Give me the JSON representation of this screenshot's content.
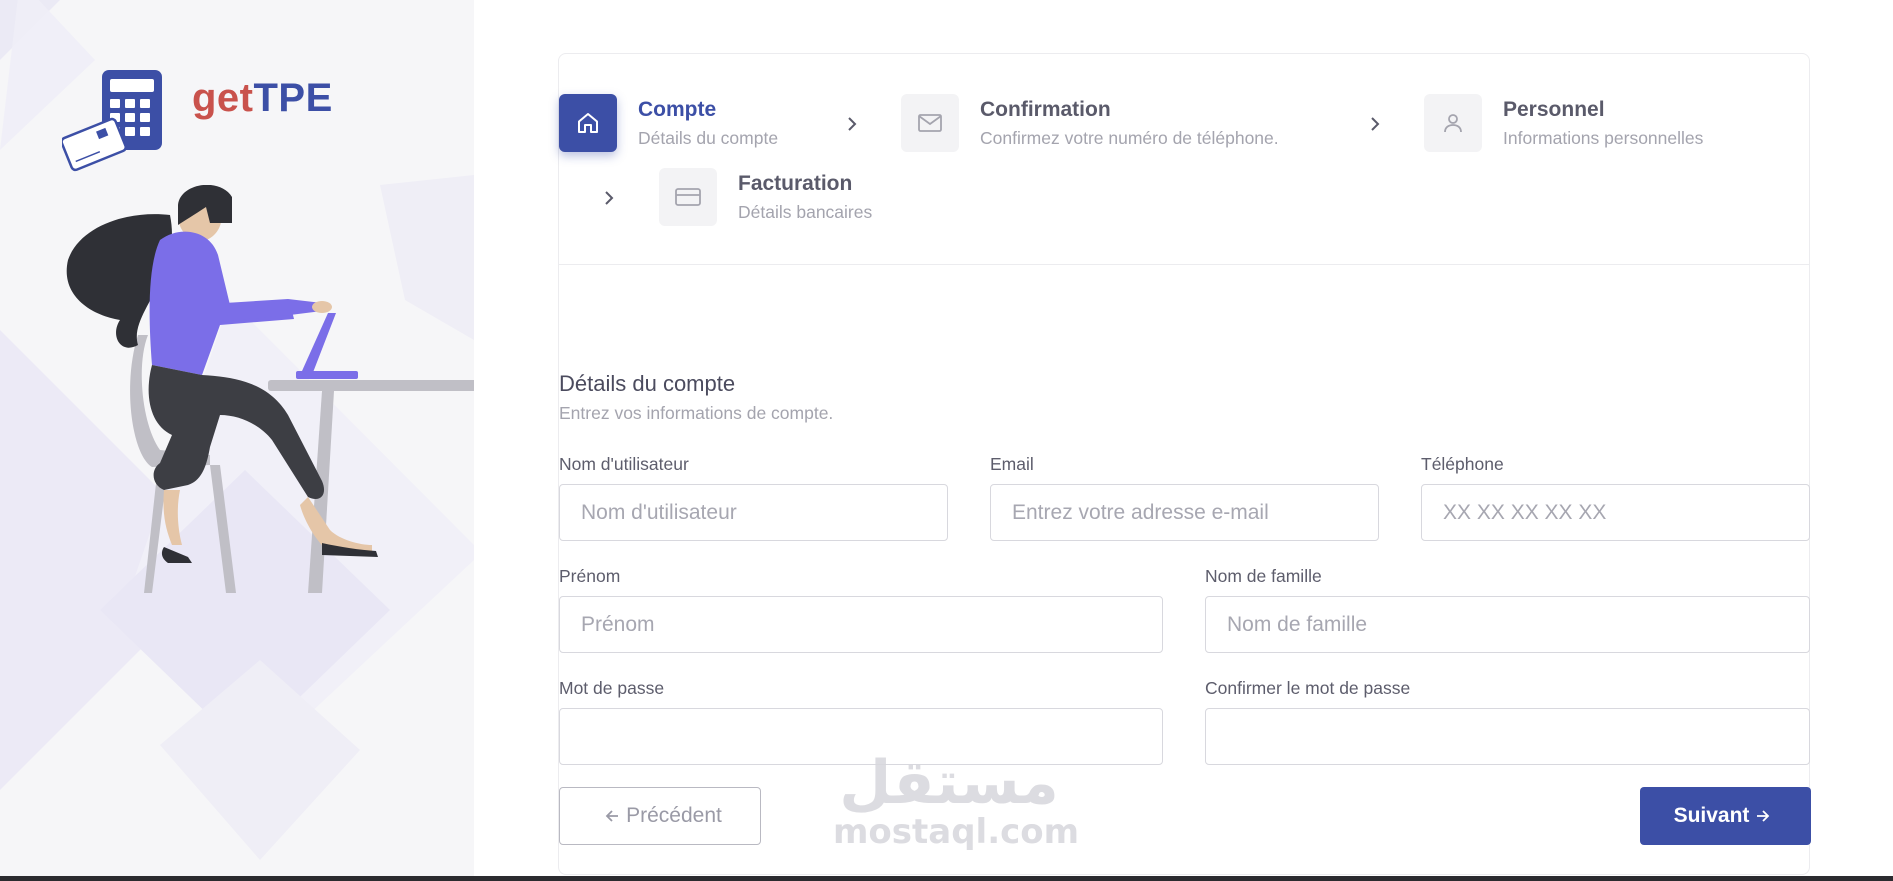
{
  "brand": {
    "logo_part1": "get",
    "logo_part2": "TPE",
    "colors": {
      "primary": "#3c4fa6",
      "logo_red": "#c9524c"
    }
  },
  "stepper": {
    "steps": [
      {
        "title": "Compte",
        "subtitle": "Détails du compte",
        "icon": "home-icon",
        "active": true
      },
      {
        "title": "Confirmation",
        "subtitle": "Confirmez votre numéro de téléphone.",
        "icon": "mail-icon",
        "active": false
      },
      {
        "title": "Personnel",
        "subtitle": "Informations personnelles",
        "icon": "user-icon",
        "active": false
      },
      {
        "title": "Facturation",
        "subtitle": "Détails bancaires",
        "icon": "credit-card-icon",
        "active": false
      }
    ]
  },
  "form": {
    "title": "Détails du compte",
    "subtitle": "Entrez vos informations de compte.",
    "username": {
      "label": "Nom d'utilisateur",
      "placeholder": "Nom d'utilisateur",
      "value": ""
    },
    "email": {
      "label": "Email",
      "placeholder": "Entrez votre adresse e-mail",
      "value": ""
    },
    "phone": {
      "label": "Téléphone",
      "placeholder": "XX XX XX XX XX",
      "value": ""
    },
    "first_name": {
      "label": "Prénom",
      "placeholder": "Prénom",
      "value": ""
    },
    "last_name": {
      "label": "Nom de famille",
      "placeholder": "Nom de famille",
      "value": ""
    },
    "password": {
      "label": "Mot de passe",
      "placeholder": "",
      "value": ""
    },
    "confirm_password": {
      "label": "Confirmer le mot de passe",
      "placeholder": "",
      "value": ""
    }
  },
  "buttons": {
    "previous": "Précédent",
    "next": "Suivant"
  },
  "watermark": {
    "arabic": "مستقل",
    "latin": "mostaql.com"
  }
}
